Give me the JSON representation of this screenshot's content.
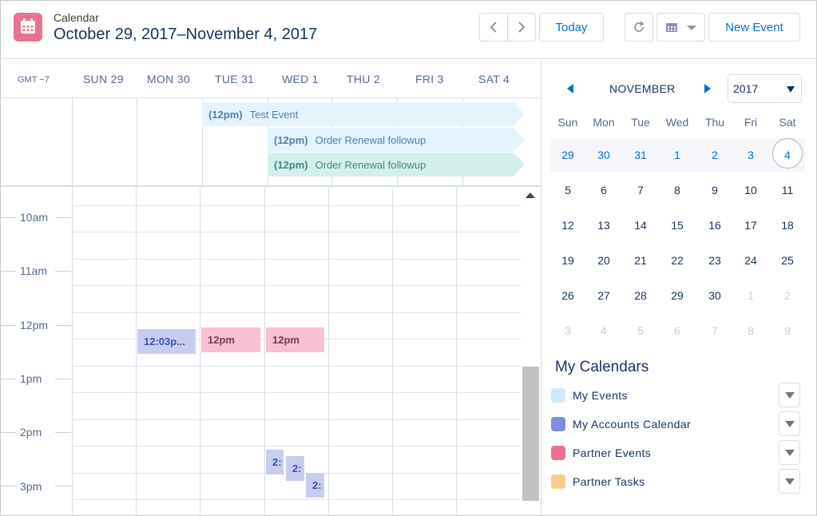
{
  "header": {
    "subtitle": "Calendar",
    "title": "October 29, 2017–November 4, 2017",
    "today_label": "Today",
    "new_event_label": "New Event",
    "logo_icon": "calendar-icon",
    "brand_color": "#eb7092"
  },
  "week": {
    "timezone": "GMT −7",
    "days": [
      "SUN 29",
      "MON 30",
      "TUE 31",
      "WED 1",
      "THU 2",
      "FRI 3",
      "SAT 4"
    ],
    "all_day_events": [
      {
        "time": "(12pm)",
        "title": "Test Event",
        "color": "#e5f3fd",
        "text_color": "#4f7fa8"
      },
      {
        "time": "(12pm)",
        "title": "Order Renewal followup",
        "color": "#e5f3fd",
        "text_color": "#4f7fa8"
      },
      {
        "time": "(12pm)",
        "title": "Order Renewal followup",
        "color": "#d4f0ec",
        "text_color": "#3d8a82"
      }
    ],
    "hours": [
      "10am",
      "11am",
      "12pm",
      "1pm",
      "2pm",
      "3pm"
    ],
    "timed_events": [
      {
        "label": "12:03p...",
        "color": "#c8cdf0",
        "text_color": "#3f51a8"
      },
      {
        "label": "12pm",
        "color": "#f7c1d1",
        "text_color": "#7a3a52"
      },
      {
        "label": "12pm",
        "color": "#f7c1d1",
        "text_color": "#7a3a52"
      },
      {
        "label": "2:",
        "color": "#c8cdf0",
        "text_color": "#3f51a8"
      },
      {
        "label": "2:",
        "color": "#c8cdf0",
        "text_color": "#3f51a8"
      },
      {
        "label": "2:",
        "color": "#c8cdf0",
        "text_color": "#3f51a8"
      }
    ]
  },
  "mini_calendar": {
    "month": "NOVEMBER",
    "year": "2017",
    "weekdays": [
      "Sun",
      "Mon",
      "Tue",
      "Wed",
      "Thu",
      "Fri",
      "Sat"
    ],
    "weeks": [
      [
        "29",
        "30",
        "31",
        "1",
        "2",
        "3",
        "4"
      ],
      [
        "5",
        "6",
        "7",
        "8",
        "9",
        "10",
        "11"
      ],
      [
        "12",
        "13",
        "14",
        "15",
        "16",
        "17",
        "18"
      ],
      [
        "19",
        "20",
        "21",
        "22",
        "23",
        "24",
        "25"
      ],
      [
        "26",
        "27",
        "28",
        "29",
        "30",
        "1",
        "2"
      ],
      [
        "3",
        "4",
        "5",
        "6",
        "7",
        "8",
        "9"
      ]
    ],
    "selected_week_color": "#0070d2",
    "muted_color": "#c9ced6"
  },
  "my_calendars": {
    "heading": "My Calendars",
    "items": [
      {
        "name": "My Events",
        "color": "#cfe9fb"
      },
      {
        "name": "My Accounts Calendar",
        "color": "#7f8de1"
      },
      {
        "name": "Partner Events",
        "color": "#eb7092"
      },
      {
        "name": "Partner Tasks",
        "color": "#f8cd89"
      }
    ]
  }
}
